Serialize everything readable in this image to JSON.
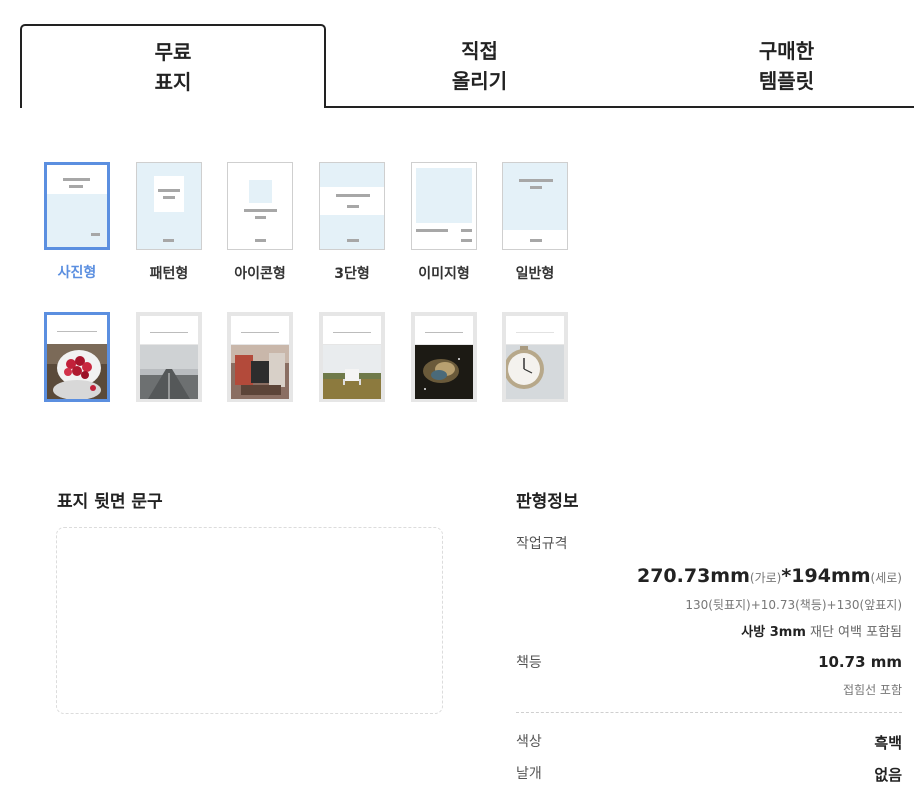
{
  "tabs": [
    {
      "label": "무료\n표지",
      "active": true
    },
    {
      "label": "직접\n올리기",
      "active": false
    },
    {
      "label": "구매한\n템플릿",
      "active": false
    }
  ],
  "templates": [
    {
      "label": "사진형",
      "selected": true
    },
    {
      "label": "패턴형",
      "selected": false
    },
    {
      "label": "아이콘형",
      "selected": false
    },
    {
      "label": "3단형",
      "selected": false
    },
    {
      "label": "이미지형",
      "selected": false
    },
    {
      "label": "일반형",
      "selected": false
    }
  ],
  "photos": [
    {
      "name": "raspberries",
      "selected": true
    },
    {
      "name": "road",
      "selected": false
    },
    {
      "name": "bag",
      "selected": false
    },
    {
      "name": "field-bench",
      "selected": false
    },
    {
      "name": "nebula",
      "selected": false
    },
    {
      "name": "clock",
      "selected": false
    }
  ],
  "back_cover": {
    "title": "표지 뒷면 문구",
    "text": ""
  },
  "spec": {
    "title": "판형정보",
    "work_size_label": "작업규격",
    "width_value": "270.73mm",
    "width_unit": "(가로)",
    "times": "*",
    "height_value": "194mm",
    "height_unit": "(세로)",
    "breakdown": "130(뒷표지)+10.73(책등)+130(앞표지)",
    "bleed_bold": "사방 3mm",
    "bleed_text": " 재단 여백 포함됨",
    "spine_label": "책등",
    "spine_value": "10.73 mm",
    "spine_note": "접힘선 포함",
    "color_label": "색상",
    "color_value": "흑백",
    "wing_label": "날개",
    "wing_value": "없음"
  },
  "colors": {
    "accent": "#5b8fe0",
    "thumb_blue": "#e4f1f8"
  }
}
